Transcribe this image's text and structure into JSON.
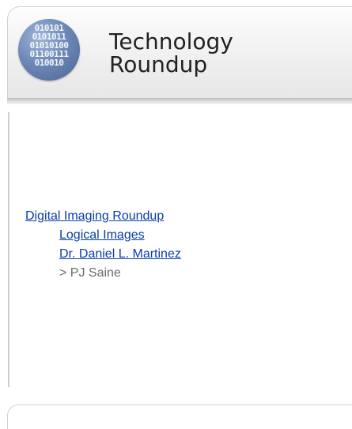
{
  "header": {
    "title_line1": "Technology",
    "title_line2": "Roundup",
    "logo_bits": [
      "010101",
      "0101011",
      "01010100",
      "01100111",
      "010010"
    ]
  },
  "nav": {
    "parent_link": "Digital Imaging Roundup",
    "child_link_1": "Logical Images",
    "child_link_2": "Dr. Daniel L. Martinez",
    "current_item": "> PJ Saine"
  },
  "colors": {
    "link": "#0b3da8",
    "current_text": "#6b6b6b",
    "title_text": "#222222"
  }
}
